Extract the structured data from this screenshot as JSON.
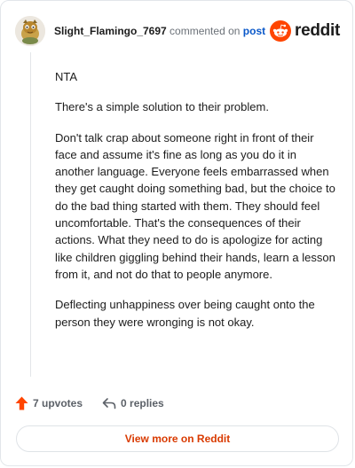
{
  "header": {
    "username": "Slight_Flamingo_7697",
    "commented_text": "commented on",
    "post_link": "post",
    "brand": "reddit",
    "logo_icon": "reddit-alien-icon",
    "avatar_icon": "avatar-image"
  },
  "comment": {
    "paragraphs": [
      "NTA",
      "There's a simple solution to their problem.",
      "Don't talk crap about someone right in front of their face and assume it's fine as long as you do it in another language. Everyone feels embarrassed when they get caught doing something bad, but the choice to do the bad thing started with them. They should feel uncomfortable. That's the consequences of their actions. What they need to do is apologize for acting like children giggling behind their hands, learn a lesson from it, and not do that to people anymore.",
      "Deflecting unhappiness over being caught onto the person they were wronging is not okay."
    ]
  },
  "actions": {
    "upvotes": "7 upvotes",
    "replies": "0 replies",
    "upvote_icon": "upvote-arrow-icon",
    "reply_icon": "reply-arrow-icon"
  },
  "footer": {
    "view_more": "View more on Reddit"
  },
  "colors": {
    "brand_orange": "#ff4500",
    "link_blue": "#0a58c9",
    "view_more_text": "#d93a00"
  }
}
